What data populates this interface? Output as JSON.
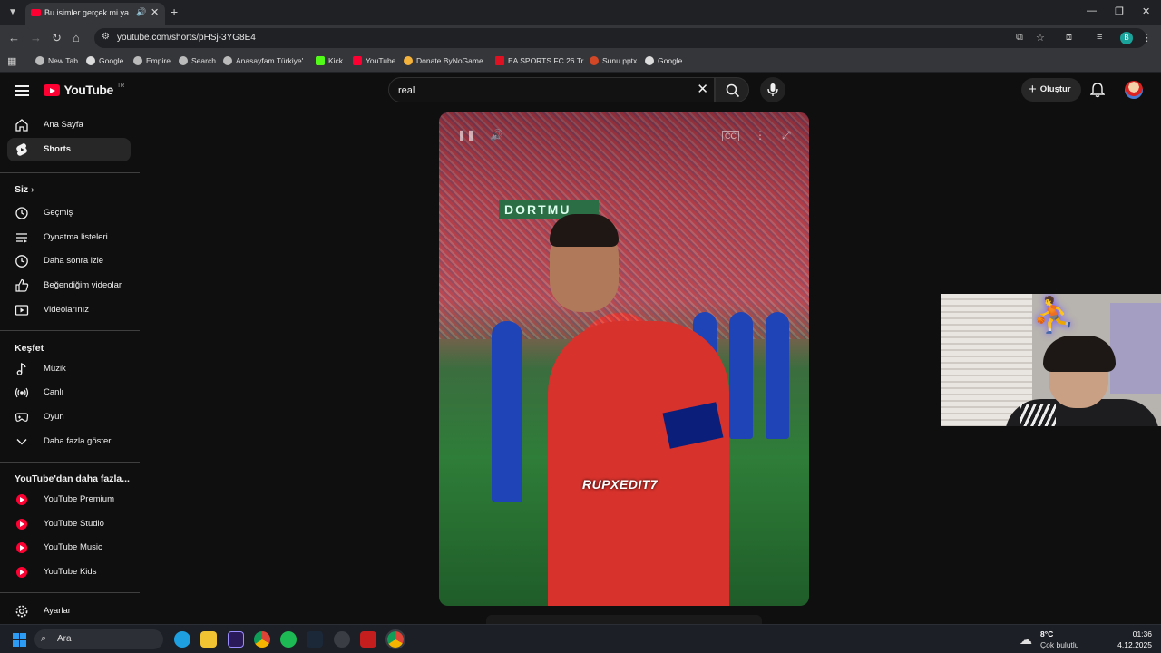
{
  "browser": {
    "tab_title": "Bu isimler gerçek mi ya",
    "url": "youtube.com/shorts/pHSj-3YG8E4",
    "profile_initial": "B",
    "bookmarks": [
      {
        "label": "New Tab",
        "icon": "globe-icon"
      },
      {
        "label": "Google",
        "icon": "google-icon"
      },
      {
        "label": "Empire",
        "icon": "globe-icon"
      },
      {
        "label": "Search",
        "icon": "globe-icon"
      },
      {
        "label": "Anasayfam Türkiye'...",
        "icon": "globe-icon"
      },
      {
        "label": "Kick",
        "icon": "kick-icon"
      },
      {
        "label": "YouTube",
        "icon": "youtube-icon"
      },
      {
        "label": "Donate ByNoGame...",
        "icon": "donate-icon"
      },
      {
        "label": "EA SPORTS FC 26 Tr...",
        "icon": "ea-icon"
      },
      {
        "label": "Sunu.pptx",
        "icon": "pptx-icon"
      },
      {
        "label": "Google",
        "icon": "google-icon"
      }
    ]
  },
  "youtube": {
    "logo_text": "YouTube",
    "logo_country": "TR",
    "search_value": "real",
    "create_label": "Oluştur",
    "sidebar": {
      "main": [
        {
          "label": "Ana Sayfa",
          "icon": "home-icon"
        },
        {
          "label": "Shorts",
          "icon": "shorts-icon",
          "active": true
        }
      ],
      "you_heading": "Siz",
      "you_items": [
        {
          "label": "Geçmiş",
          "icon": "history-icon"
        },
        {
          "label": "Oynatma listeleri",
          "icon": "playlist-icon"
        },
        {
          "label": "Daha sonra izle",
          "icon": "clock-icon"
        },
        {
          "label": "Beğendiğim videolar",
          "icon": "like-icon"
        },
        {
          "label": "Videolarınız",
          "icon": "video-icon"
        }
      ],
      "explore_heading": "Keşfet",
      "explore_items": [
        {
          "label": "Müzik",
          "icon": "music-icon"
        },
        {
          "label": "Canlı",
          "icon": "live-icon"
        },
        {
          "label": "Oyun",
          "icon": "gaming-icon"
        },
        {
          "label": "Daha fazla göster",
          "icon": "chevron-down-icon"
        }
      ],
      "more_heading": "YouTube'dan daha fazla...",
      "more_items": [
        {
          "label": "YouTube Premium"
        },
        {
          "label": "YouTube Studio"
        },
        {
          "label": "YouTube Music"
        },
        {
          "label": "YouTube Kids"
        }
      ],
      "settings_label": "Ayarlar"
    },
    "short": {
      "stadium_sign": "DORTMU",
      "watermark": "RUPXEDIT7"
    }
  },
  "taskbar": {
    "search_placeholder": "Ara",
    "temperature": "8°C",
    "weather": "Çok bulutlu",
    "time": "01:36",
    "date": "4.12.2025"
  },
  "colors": {
    "accent_red": "#ff0033",
    "background": "#0f0f0f",
    "active_item": "#272727"
  }
}
